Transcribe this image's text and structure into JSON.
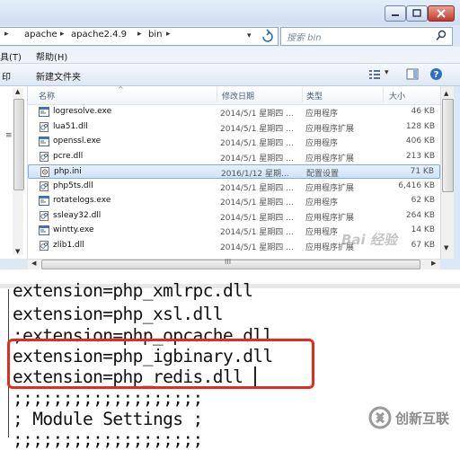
{
  "window": {
    "controls": {
      "minimize": "minimize-icon",
      "maximize": "maximize-icon",
      "close": "close-icon"
    }
  },
  "address": {
    "crumbs": [
      "apache",
      "apache2.4.9",
      "bin"
    ],
    "search_placeholder": "搜索 bin"
  },
  "menu": {
    "items": [
      "具(T)",
      "帮助(H)"
    ]
  },
  "toolbar": {
    "left_label": "印",
    "new_folder": "新建文件夹"
  },
  "columns": {
    "name": "名称",
    "date": "修改日期",
    "type": "类型",
    "size": "大小"
  },
  "files": [
    {
      "name": "logresolve.exe",
      "date": "2014/5/1 星期四 ...",
      "type": "应用程序",
      "size": "46 KB",
      "kind": "exe"
    },
    {
      "name": "lua51.dll",
      "date": "2014/5/1 星期四 ...",
      "type": "应用程序扩展",
      "size": "128 KB",
      "kind": "dll"
    },
    {
      "name": "openssl.exe",
      "date": "2014/5/1 星期四 ...",
      "type": "应用程序",
      "size": "406 KB",
      "kind": "exe"
    },
    {
      "name": "pcre.dll",
      "date": "2014/5/1 星期四 ...",
      "type": "应用程序扩展",
      "size": "213 KB",
      "kind": "dll"
    },
    {
      "name": "php.ini",
      "date": "2016/1/12 星期...",
      "type": "配置设置",
      "size": "71 KB",
      "kind": "ini",
      "selected": true
    },
    {
      "name": "php5ts.dll",
      "date": "2014/5/1 星期四 ...",
      "type": "应用程序扩展",
      "size": "6,416 KB",
      "kind": "dll"
    },
    {
      "name": "rotatelogs.exe",
      "date": "2014/5/1 星期四 ...",
      "type": "应用程序",
      "size": "62 KB",
      "kind": "exe"
    },
    {
      "name": "ssleay32.dll",
      "date": "2014/5/1 星期四 ...",
      "type": "应用程序扩展",
      "size": "264 KB",
      "kind": "dll"
    },
    {
      "name": "wintty.exe",
      "date": "2014/5/1 星期四 ...",
      "type": "应用程序",
      "size": "14 KB",
      "kind": "exe"
    },
    {
      "name": "zlib1.dll",
      "date": "2014/5/1 星期四 ...",
      "type": "应用程序扩展",
      "size": "67 KB",
      "kind": "dll"
    }
  ],
  "watermark": "Bai 经验",
  "scrollbar": {
    "grip": "III"
  },
  "editor": {
    "lines": [
      "extension=php_xmlrpc.dll",
      "extension=php_xsl.dll",
      ";extension=php_opcache.dll",
      "extension=php_igbinary.dll",
      "extension=php_redis.dll",
      ";;;;;;;;;;;;;;;;;;;",
      "; Module Settings ;",
      ";;;;;;;;;;;;;;;;;;;"
    ],
    "highlight_color": "#e32b22"
  },
  "brand": {
    "name": "创新互联"
  }
}
